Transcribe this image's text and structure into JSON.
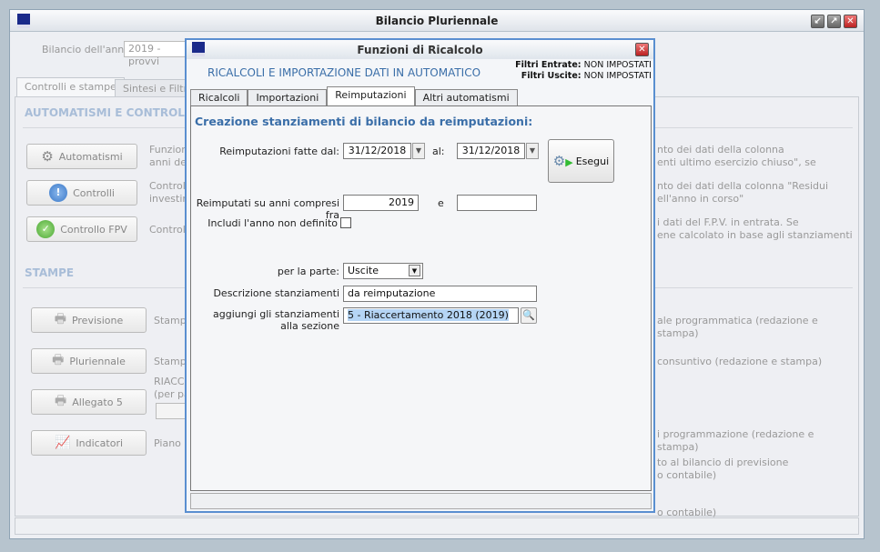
{
  "main_window": {
    "title": "Bilancio Pluriennale",
    "year_label": "Bilancio dell'anno:",
    "year_value": "2019 - provvi",
    "tabs": [
      {
        "label": "Controlli e stampe"
      },
      {
        "label": "Sintesi e Filtri"
      }
    ],
    "section_auto": "AUTOMATISMI E CONTROLLI",
    "section_print": "STAMPE",
    "buttons": [
      {
        "label": "Automatismi",
        "desc1": "Funzioni",
        "desc2": "anni del",
        "rdesc1": "nto dei dati della colonna",
        "rdesc2": "enti ultimo esercizio chiuso\", se"
      },
      {
        "label": "Controlli",
        "desc1": "Controlli",
        "desc2": "investim",
        "rdesc1": "nto dei dati della colonna \"Residui",
        "rdesc2": "ell'anno in corso\""
      },
      {
        "label": "Controllo FPV",
        "desc1": "Controllo",
        "desc2": "",
        "rdesc1": "i dati del F.P.V. in entrata. Se",
        "rdesc2": "ene calcolato in base agli stanziamenti"
      }
    ],
    "prints": [
      {
        "label": "Previsione",
        "desc1": "Stampa",
        "rdesc1": "ale programmatica (redazione e stampa)"
      },
      {
        "label": "Pluriennale",
        "desc1": "Stampa",
        "rdesc1": "consuntivo (redazione e stampa)"
      },
      {
        "label": "Allegato 5",
        "desc1": "RIACCE",
        "desc2": "(per pa",
        "rdesc1": ""
      },
      {
        "label": "Indicatori",
        "desc1": "Piano d",
        "rdesc1": "i programmazione (redazione e stampa)"
      }
    ],
    "extra_right": [
      "to al bilancio di previsione",
      "o contabile)",
      "o contabile)"
    ]
  },
  "dialog": {
    "title": "Funzioni di Ricalcolo",
    "heading": "RICALCOLI E IMPORTAZIONE DATI IN AUTOMATICO",
    "filter_in_label": "Filtri Entrate:",
    "filter_in_value": "NON IMPOSTATI",
    "filter_out_label": "Filtri Uscite:",
    "filter_out_value": "NON IMPOSTATI",
    "tabs": [
      {
        "label": "Ricalcoli"
      },
      {
        "label": "Importazioni"
      },
      {
        "label": "Reimputazioni"
      },
      {
        "label": "Altri automatismi"
      }
    ],
    "subtitle": "Creazione stanziamenti di bilancio da reimputazioni:",
    "from_label": "Reimputazioni fatte dal:",
    "from_value": "31/12/2018",
    "to_label": "al:",
    "to_value": "31/12/2018",
    "execute_label": "Esegui",
    "years_label": "Reimputati su anni compresi fra",
    "year_from": "2019",
    "and_label": "e",
    "year_to": "",
    "include_label": "Includi l'anno non definito",
    "include_checked": false,
    "part_label": "per la parte:",
    "part_value": "Uscite",
    "desc_label": "Descrizione stanziamenti",
    "desc_value": "da reimputazione",
    "section_label1": "aggiungi gli stanziamenti",
    "section_label2": "alla sezione",
    "section_value": "5 - Riaccertamento 2018 (2019)"
  }
}
